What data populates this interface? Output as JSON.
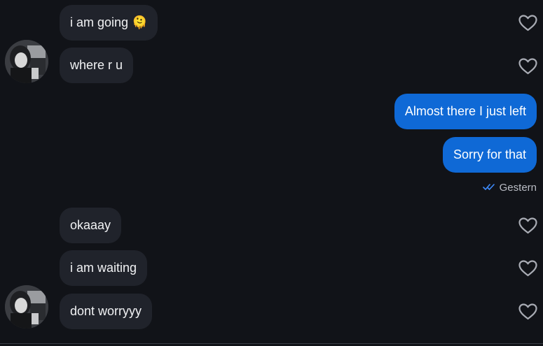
{
  "messages": [
    {
      "text": "i am going 🫠",
      "direction": "incoming"
    },
    {
      "text": "where r u",
      "direction": "incoming"
    },
    {
      "text": "Almost there I just left",
      "direction": "outgoing"
    },
    {
      "text": "Sorry for that",
      "direction": "outgoing"
    },
    {
      "text": "okaaay",
      "direction": "incoming"
    },
    {
      "text": "i am waiting",
      "direction": "incoming"
    },
    {
      "text": "dont worryyy",
      "direction": "incoming"
    }
  ],
  "read_status": {
    "label": "Gestern",
    "icon": "double-check-icon"
  },
  "colors": {
    "background": "#111318",
    "incoming_bubble": "#20232b",
    "outgoing_bubble": "#0f69d6",
    "read_check": "#3d8bfd"
  }
}
